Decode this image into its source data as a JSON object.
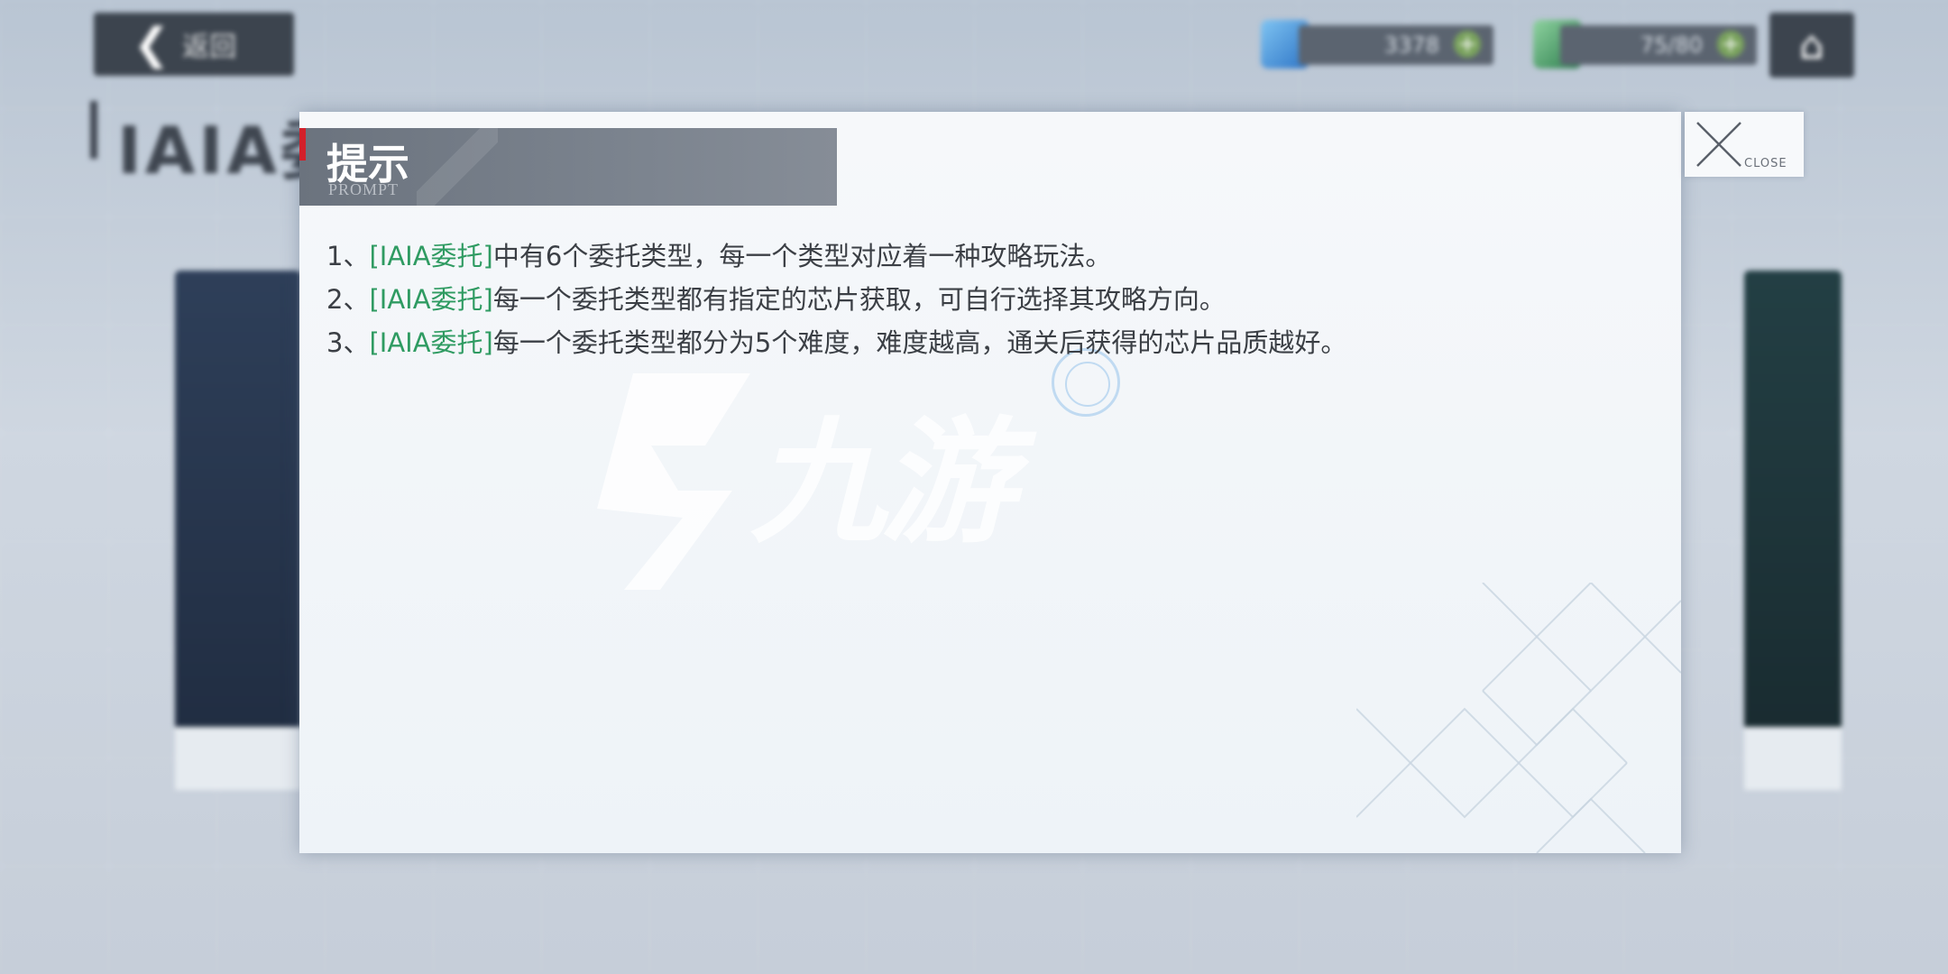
{
  "background": {
    "back_label": "返回",
    "page_title": "IAIA委托",
    "currency_1": "3378",
    "currency_2": "75/80"
  },
  "dialog": {
    "title": "提示",
    "subtitle": "PROMPT",
    "close_label": "CLOSE",
    "tips": [
      {
        "num": "1、",
        "tag": "[IAIA委托]",
        "text": "中有6个委托类型，每一个类型对应着一种攻略玩法。"
      },
      {
        "num": "2、",
        "tag": "[IAIA委托]",
        "text": "每一个委托类型都有指定的芯片获取，可自行选择其攻略方向。"
      },
      {
        "num": "3、",
        "tag": "[IAIA委托]",
        "text": "每一个委托类型都分为5个难度，难度越高，通关后获得的芯片品质越好。"
      }
    ]
  },
  "watermark": {
    "text": "九游"
  },
  "colors": {
    "accent": "#d3202a",
    "tag_green": "#2f9b62",
    "header_bg": "#737b86"
  }
}
